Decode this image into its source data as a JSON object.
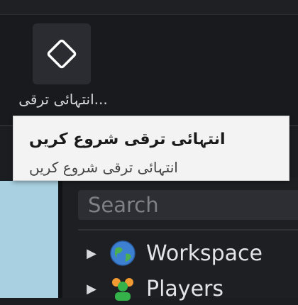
{
  "ribbon": {
    "tool": {
      "icon": "diamond-icon",
      "label": "...انتہائی ترقی"
    }
  },
  "tooltip": {
    "title": "انتہائی ترقی شروع کریں",
    "description": "انتہائی ترقی شروع کریں"
  },
  "explorer": {
    "search_placeholder": "Search",
    "items": [
      {
        "label": "Workspace",
        "icon": "globe-icon"
      },
      {
        "label": "Players",
        "icon": "players-icon"
      }
    ]
  },
  "colors": {
    "background": "#1b1d21",
    "tooltip_bg": "#f3f3f3",
    "text_primary": "#e3e4e6",
    "viewport_sky": "#a8d0e0",
    "globe_blue": "#3d7fd0",
    "globe_green": "#4caf50",
    "players_orange": "#f29a32",
    "players_green": "#36b24a"
  }
}
